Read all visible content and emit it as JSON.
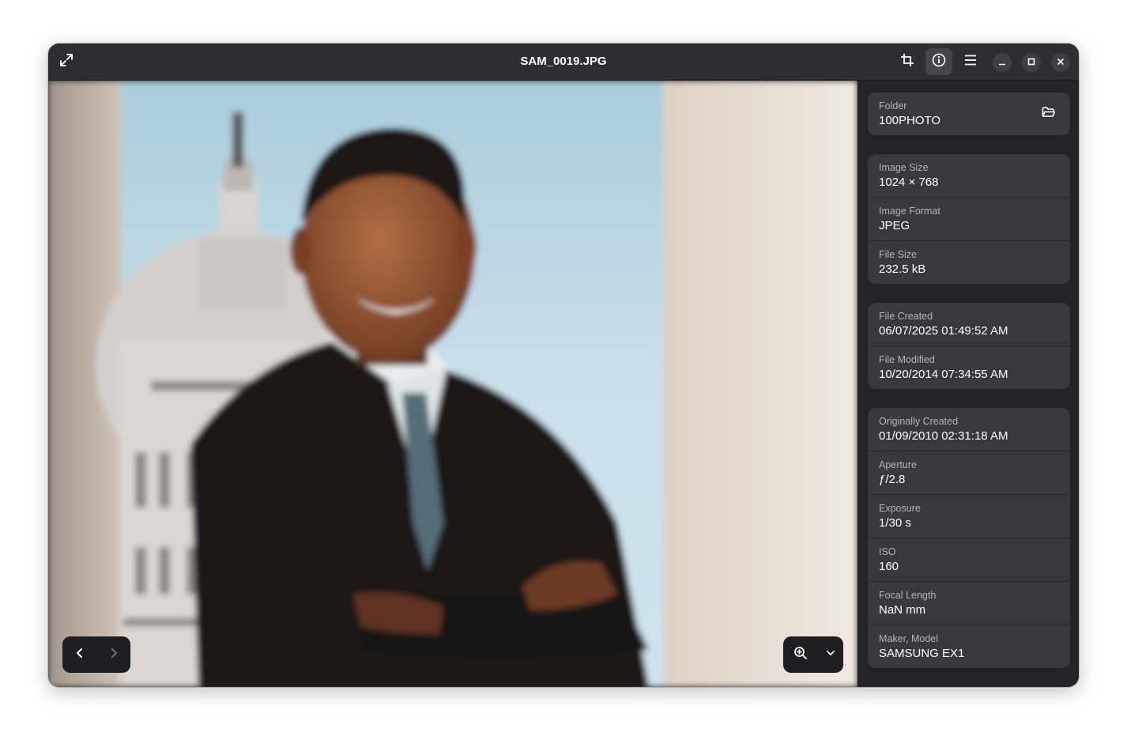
{
  "window": {
    "title": "SAM_0019.JPG"
  },
  "headerbar": {
    "icons": [
      "fullscreen-icon",
      "crop-icon",
      "info-icon",
      "menu-icon",
      "minimize-icon",
      "maximize-icon",
      "close-icon"
    ]
  },
  "sidebar": {
    "folder": {
      "label": "Folder",
      "value": "100PHOTO",
      "icon": "open-folder-icon"
    },
    "image_info": [
      {
        "label": "Image Size",
        "value": "1024 × 768"
      },
      {
        "label": "Image Format",
        "value": "JPEG"
      },
      {
        "label": "File Size",
        "value": "232.5 kB"
      }
    ],
    "dates": [
      {
        "label": "File Created",
        "value": "06/07/2025 01:49:52 AM"
      },
      {
        "label": "File Modified",
        "value": "10/20/2014 07:34:55 AM"
      }
    ],
    "exif": [
      {
        "label": "Originally Created",
        "value": "01/09/2010 02:31:18 AM"
      },
      {
        "label": "Aperture",
        "value": "ƒ/2.8"
      },
      {
        "label": "Exposure",
        "value": "1/30 s"
      },
      {
        "label": "ISO",
        "value": "160"
      },
      {
        "label": "Focal Length",
        "value": "NaN mm"
      },
      {
        "label": "Maker, Model",
        "value": "SAMSUNG EX1"
      }
    ]
  },
  "osd": {
    "nav_icons": [
      "previous-icon",
      "next-icon"
    ],
    "zoom_icons": [
      "zoom-in-icon",
      "chevron-down-icon"
    ]
  },
  "colors": {
    "window_bg": "#242428",
    "header_bg": "#2e2e32",
    "card_bg": "#38383d",
    "osd_bg": "#1e1e20"
  }
}
